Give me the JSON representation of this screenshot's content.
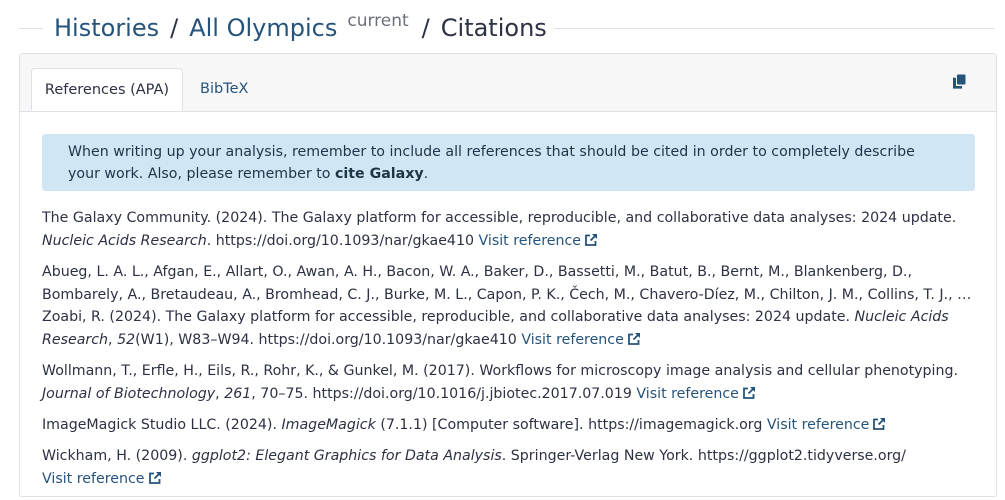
{
  "breadcrumb": {
    "histories": "Histories",
    "sep1": "/",
    "history_name": "All Olympics",
    "badge": "current",
    "sep2": "/",
    "current": "Citations"
  },
  "tabs": [
    {
      "label": "References (APA)",
      "active": true
    },
    {
      "label": "BibTeX",
      "active": false
    }
  ],
  "copy_icon": "copy-icon",
  "alert": {
    "text": "When writing up your analysis, remember to include all references that should be cited in order to completely describe your work. Also, please remember to ",
    "link": "cite Galaxy",
    "end": "."
  },
  "visit_label": "Visit reference",
  "references": [
    {
      "pre": "The Galaxy Community. (2024). The Galaxy platform for accessible, reproducible, and collaborative data analyses: 2024 update. ",
      "journal": "Nucleic Acids Research",
      "post": ". https://doi.org/10.1093/nar/gkae410 "
    },
    {
      "pre": "Abueg, L. A. L., Afgan, E., Allart, O., Awan, A. H., Bacon, W. A., Baker, D., Bassetti, M., Batut, B., Bernt, M., Blankenberg, D., Bombarely, A., Bretaudeau, A., Bromhead, C. J., Burke, M. L., Capon, P. K., Čech, M., Chavero-Díez, M., Chilton, J. M., Collins, T. J., … Zoabi, R. (2024). The Galaxy platform for accessible, reproducible, and collaborative data analyses: 2024 update. ",
      "journal": "Nucleic Acids Research",
      "mid": ", ",
      "volume": "52",
      "post": "(W1), W83–W94. https://doi.org/10.1093/nar/gkae410 "
    },
    {
      "pre": "Wollmann, T., Erfle, H., Eils, R., Rohr, K., & Gunkel, M. (2017). Workflows for microscopy image analysis and cellular phenotyping. ",
      "journal": "Journal of Biotechnology",
      "mid": ", ",
      "volume": "261",
      "post": ", 70–75. https://doi.org/10.1016/j.jbiotec.2017.07.019 "
    },
    {
      "pre": "ImageMagick Studio LLC. (2024). ",
      "journal": "ImageMagick",
      "post": " (7.1.1) [Computer software]. https://imagemagick.org "
    },
    {
      "pre": "Wickham, H. (2009). ",
      "journal": "ggplot2: Elegant Graphics for Data Analysis",
      "post": ". Springer-Verlag New York. https://ggplot2.tidyverse.org/ "
    }
  ],
  "colors": {
    "link": "#25537b",
    "alert_bg": "#d1e6f5",
    "border": "#dee2e6"
  }
}
